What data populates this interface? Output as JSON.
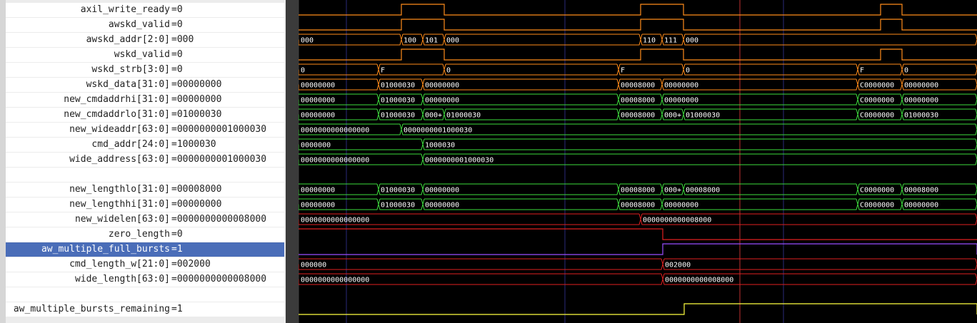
{
  "signals": [
    {
      "name": "axil_write_ready",
      "value": "=0",
      "color": "#ff8c1a",
      "kind": "bit"
    },
    {
      "name": "awskd_valid",
      "value": "=0",
      "color": "#ff8c1a",
      "kind": "bit"
    },
    {
      "name": "awskd_addr[2:0]",
      "value": "=000",
      "color": "#ff8c1a",
      "kind": "bus",
      "segments": [
        "000",
        "100",
        "101",
        "000",
        "110",
        "111",
        "000"
      ]
    },
    {
      "name": "wskd_valid",
      "value": "=0",
      "color": "#ff8c1a",
      "kind": "bit"
    },
    {
      "name": "wskd_strb[3:0]",
      "value": "=0",
      "color": "#ff8c1a",
      "kind": "bus",
      "segments": [
        "0",
        "F",
        "0",
        "F",
        "0",
        "F",
        "0"
      ]
    },
    {
      "name": "wskd_data[31:0]",
      "value": "=00000000",
      "color": "#ff8c1a",
      "kind": "bus",
      "segments": [
        "00000000",
        "01000030",
        "00000000",
        "00008000",
        "00000000",
        "C0000000",
        "00000000"
      ]
    },
    {
      "name": "new_cmdaddrhi[31:0]",
      "value": "=00000000",
      "color": "#3ddc3d",
      "kind": "bus",
      "segments": [
        "00000000",
        "01000030",
        "00000000",
        "00008000",
        "00000000",
        "C0000000",
        "00000000"
      ]
    },
    {
      "name": "new_cmdaddrlo[31:0]",
      "value": "=01000030",
      "color": "#3ddc3d",
      "kind": "bus",
      "segments": [
        "00000000",
        "01000030",
        "000+",
        "01000030",
        "00008000",
        "000+",
        "01000030",
        "C0000000",
        "01000030"
      ]
    },
    {
      "name": "new_wideaddr[63:0]",
      "value": "=0000000001000030",
      "color": "#3ddc3d",
      "kind": "bus",
      "segments": [
        "0000000000000000",
        "0000000001000030"
      ]
    },
    {
      "name": "cmd_addr[24:0]",
      "value": "=1000030",
      "color": "#3ddc3d",
      "kind": "bus",
      "segments": [
        "0000000",
        "1000030"
      ]
    },
    {
      "name": "wide_address[63:0]",
      "value": "=0000000001000030",
      "color": "#3ddc3d",
      "kind": "bus",
      "segments": [
        "0000000000000000",
        "0000000001000030"
      ]
    },
    {
      "name": "",
      "value": "",
      "color": "#000",
      "kind": "blank"
    },
    {
      "name": "new_lengthlo[31:0]",
      "value": "=00008000",
      "color": "#3ddc3d",
      "kind": "bus",
      "segments": [
        "00000000",
        "01000030",
        "00000000",
        "00008000",
        "000+",
        "00008000",
        "C0000000",
        "00008000"
      ]
    },
    {
      "name": "new_lengthhi[31:0]",
      "value": "=00000000",
      "color": "#3ddc3d",
      "kind": "bus",
      "segments": [
        "00000000",
        "01000030",
        "00000000",
        "00008000",
        "00000000",
        "C0000000",
        "00000000"
      ]
    },
    {
      "name": "new_widelen[63:0]",
      "value": "=0000000000008000",
      "color": "#e02020",
      "kind": "bus",
      "segments": [
        "0000000000000000",
        "0000000000008000"
      ]
    },
    {
      "name": "zero_length",
      "value": "=0",
      "color": "#e02020",
      "kind": "bit"
    },
    {
      "name": "aw_multiple_full_bursts",
      "value": "=1",
      "color": "#9a4dff",
      "kind": "bit",
      "selected": true
    },
    {
      "name": "cmd_length_w[21:0]",
      "value": "=002000",
      "color": "#e02020",
      "kind": "bus",
      "segments": [
        "000000",
        "002000"
      ]
    },
    {
      "name": "wide_length[63:0]",
      "value": "=0000000000008000",
      "color": "#e02020",
      "kind": "bus",
      "segments": [
        "0000000000000000",
        "0000000000008000"
      ]
    },
    {
      "name": "",
      "value": "",
      "color": "#000",
      "kind": "blank"
    },
    {
      "name": "aw_multiple_bursts_remaining",
      "value": "=1",
      "color": "#ffff40",
      "kind": "bit"
    }
  ]
}
